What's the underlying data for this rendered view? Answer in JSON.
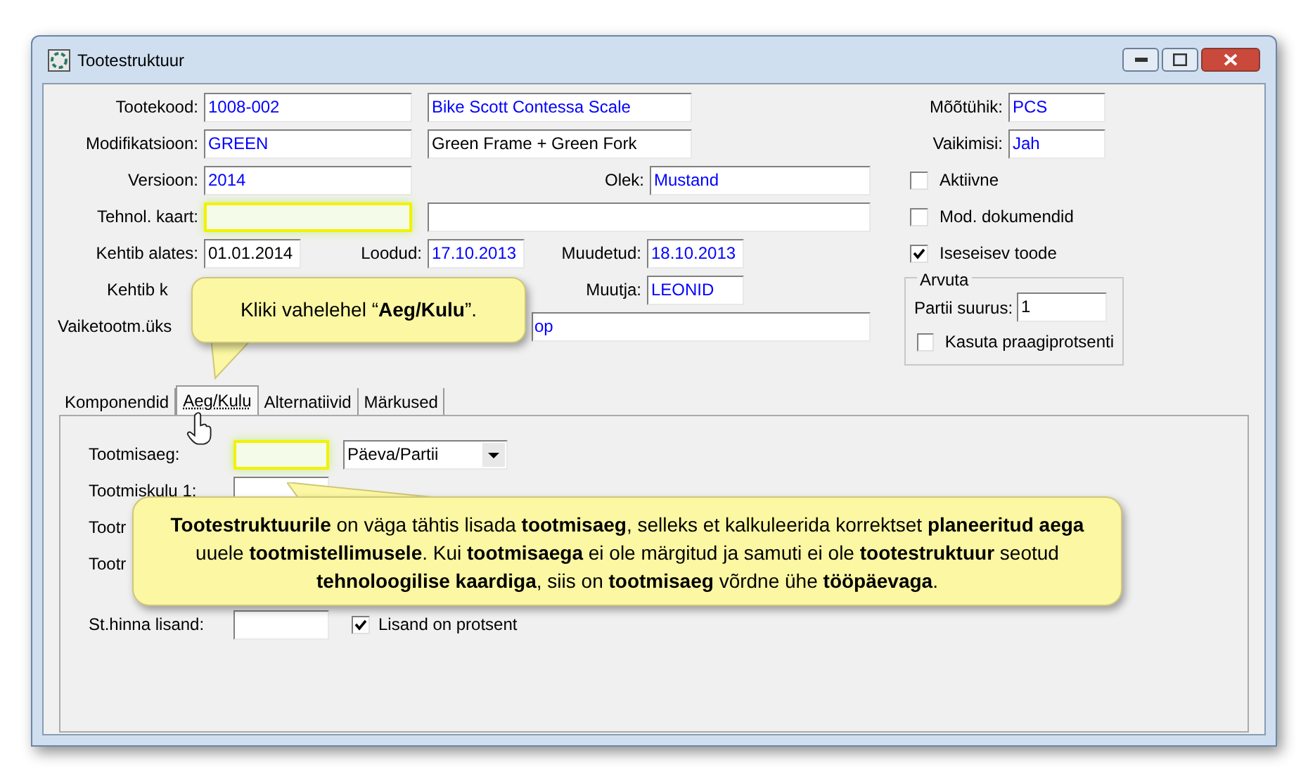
{
  "window": {
    "title": "Tootestruktuur"
  },
  "main": {
    "product_code": {
      "label": "Tootekood:",
      "code": {
        "value": "1008-002",
        "kind": "linked"
      },
      "name": {
        "value": "Bike Scott Contessa Scale",
        "kind": "linked"
      }
    },
    "modification": {
      "label": "Modifikatsioon:",
      "code": {
        "value": "GREEN",
        "kind": "linked"
      },
      "name": {
        "value": "Green Frame + Green Fork"
      }
    },
    "version": {
      "label": "Versioon:",
      "code": {
        "value": "2014",
        "kind": "linked"
      }
    },
    "status": {
      "label": "Olek:",
      "field": {
        "value": "Mustand",
        "kind": "linked"
      }
    },
    "tech_card": {
      "label": "Tehnol. kaart:",
      "code": {
        "highlighted": true
      },
      "name": {
        "highlighted": false
      }
    },
    "valid_from": {
      "label": "Kehtib alates:",
      "field": {
        "value": "01.01.2014"
      }
    },
    "created": {
      "label": "Loodud:",
      "field": {
        "value": "17.10.2013",
        "kind": "linked"
      }
    },
    "modified": {
      "label": "Muudetud:",
      "field": {
        "value": "18.10.2013",
        "kind": "linked"
      }
    },
    "valid_to": {
      "label": "Kehtib k"
    },
    "modifier": {
      "label": "Muutja:",
      "field": {
        "value": "LEONID",
        "kind": "linked"
      }
    },
    "default_unit": {
      "label": "Vaiketootm.üks",
      "name": {
        "value": "op",
        "kind": "linked"
      }
    }
  },
  "side": {
    "unit": {
      "label": "Mõõtühik:",
      "field": {
        "value": "PCS",
        "kind": "linked"
      }
    },
    "default": {
      "label": "Vaikimisi:",
      "field": {
        "value": "Jah",
        "kind": "linked"
      }
    },
    "checkboxes": [
      {
        "label": "Aktiivne",
        "checked": false
      },
      {
        "label": "Mod. dokumendid",
        "checked": false
      },
      {
        "label": "Iseseisev toode",
        "checked": true
      }
    ],
    "calc": {
      "title": "Arvuta",
      "batch": {
        "label": "Partii suurus:",
        "field": {
          "value": "1"
        }
      },
      "use_scrap": {
        "label": "Kasuta praagiprotsenti",
        "checked": false
      }
    }
  },
  "tabs": [
    {
      "label": "Komponendid",
      "selected": false
    },
    {
      "label": "Aeg/Kulu",
      "selected": true
    },
    {
      "label": "Alternatiivid",
      "selected": false
    },
    {
      "label": "Märkused",
      "selected": false
    }
  ],
  "tab_panel": {
    "rows": [
      {
        "label": "Tootmisaeg:",
        "field": {
          "highlighted": true
        },
        "extra": {
          "kind": "dropdown",
          "value": "Päeva/Partii"
        }
      },
      {
        "label": "Tootmiskulu 1:",
        "field": {
          "highlighted": false
        }
      },
      {
        "label": "Tootr"
      },
      {
        "label": "Tootr"
      },
      {
        "label": "St.hinna lisand:",
        "field": {
          "highlighted": false
        },
        "extra": {
          "kind": "checkbox",
          "label": "Lisand on protsent",
          "checked": true
        }
      }
    ]
  },
  "callouts": [
    {
      "text": "Kliki vahelehel “**Aeg/Kulu**”."
    },
    {
      "text": "**Tootestruktuurile** on väga tähtis lisada **tootmisaeg**, selleks et kalkuleerida korrektset **planeeritud aega** uuele **tootmistellimusele**. Kui **tootmisaega** ei ole märgitud ja samuti ei ole **tootestruktuur** seotud **tehnoloogilise kaardiga**, siis on **tootmisaeg** võrdne ühe **tööpäevaga**."
    }
  ]
}
